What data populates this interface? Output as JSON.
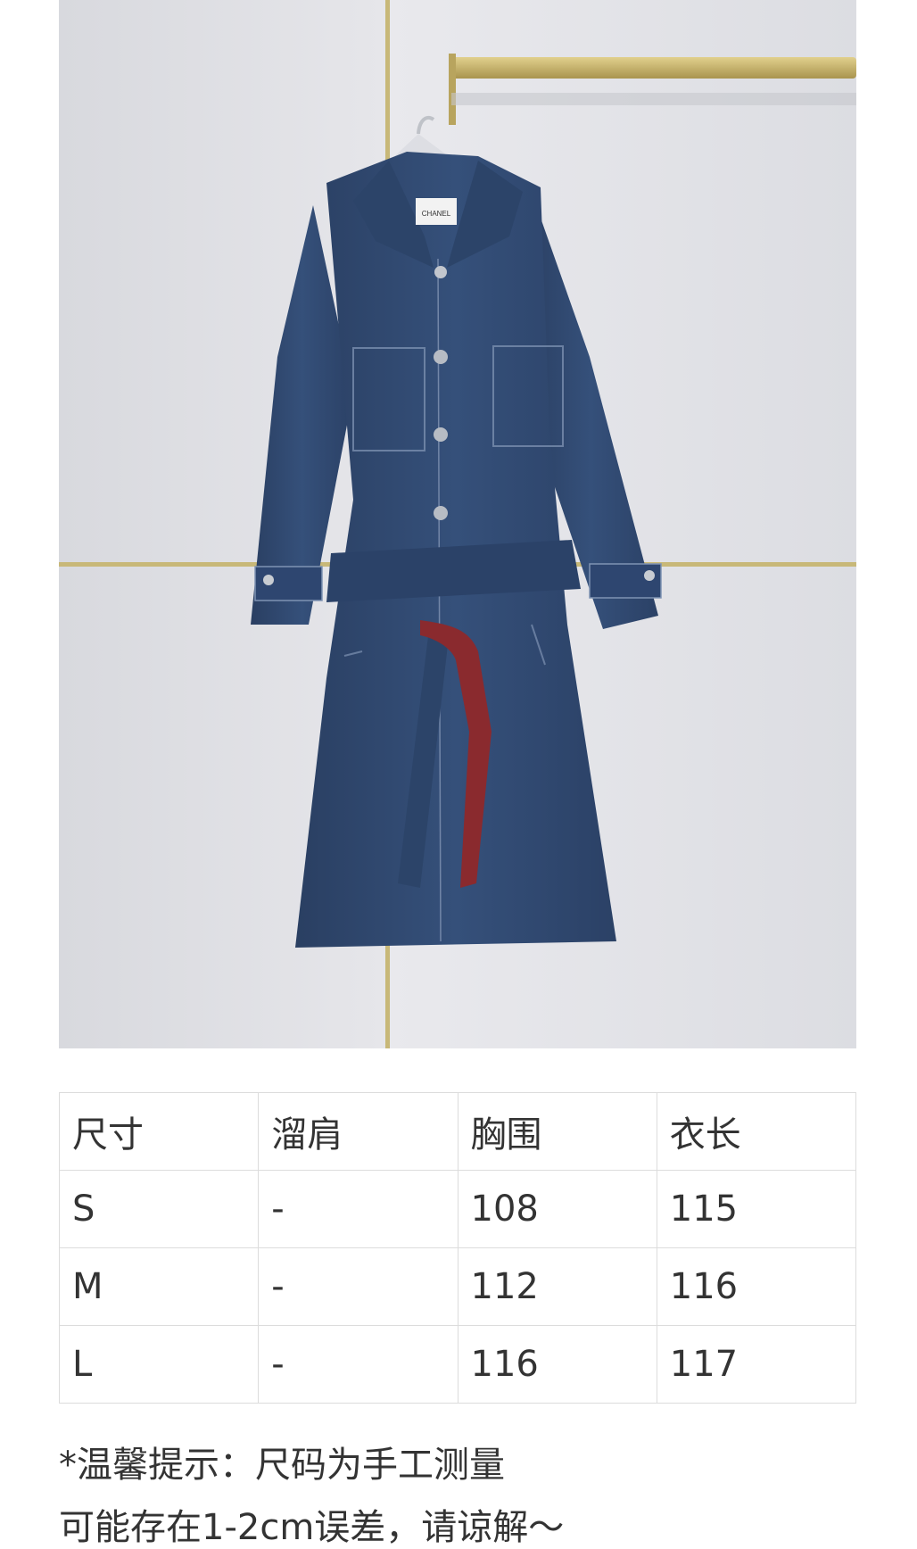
{
  "product_image": {
    "garment_label_text": "CHANEL",
    "colors": {
      "wall": "#e3e3e6",
      "denim": "#2f4a72",
      "belt_leather": "#8a2a2e",
      "brass_rail": "#c9b46e"
    }
  },
  "size_table": {
    "headers": [
      "尺寸",
      "溜肩",
      "胸围",
      "衣长"
    ],
    "rows": [
      [
        "S",
        "-",
        "108",
        "115"
      ],
      [
        "M",
        "-",
        "112",
        "116"
      ],
      [
        "L",
        "-",
        "116",
        "117"
      ]
    ]
  },
  "note": {
    "line1": "*温馨提示：尺码为手工测量",
    "line2": "可能存在1-2cm误差，请谅解～"
  }
}
